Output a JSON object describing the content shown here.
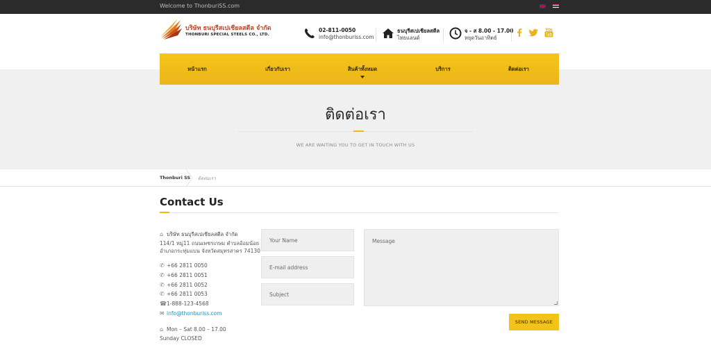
{
  "topbar": {
    "welcome": "Welcome to ThonburiSS.com",
    "flags": [
      "english-flag",
      "thai-flag"
    ]
  },
  "logo": {
    "name_th": "บริษัท ธนบุรีสเปเชียลสตีล จำกัด",
    "name_en": "THONBURI SPECIAL STEELS CO., LTD."
  },
  "header_info": [
    {
      "icon": "phone-icon",
      "line1": "02-811-0050",
      "line2": "info@thonburiss.com"
    },
    {
      "icon": "home-icon",
      "line1": "ธนบุรีสเปเชียลสตีล",
      "line2": "ไทยแลนด์"
    },
    {
      "icon": "clock-icon",
      "line1": "จ - ส 8.00 - 17.00",
      "line2": "หยุดวันอาทิตย์"
    }
  ],
  "social": [
    "facebook-icon",
    "twitter-icon",
    "youtube-icon"
  ],
  "nav": {
    "items": [
      "หน้าแรก",
      "เกี่ยวกับเรา",
      "สินค้าทั้งหมด",
      "บริการ",
      "ติดต่อเรา"
    ]
  },
  "hero": {
    "title": "ติดต่อเรา",
    "subtitle": "WE ARE WAITING YOU TO GET IN TOUCH WITH US"
  },
  "breadcrumb": {
    "home": "Thonburi SS",
    "current": "ติดต่อเรา"
  },
  "contact": {
    "heading": "Contact Us",
    "company": "บริษัท ธนบุรีสเปเชียลสตีล จำกัด",
    "address_line1": "114/1 หมู่11 ถนนเพชรเกษม ตำบลอ้อมน้อย",
    "address_line2": "อำเภอกระทุ่มแบน จังหวัดสมุทรสาคร 74130",
    "phones": [
      "+66 2811 0050",
      "+66 2811 0051",
      "+66 2811 0052",
      "+66 2811 0053"
    ],
    "fax": "1-888-123-4568",
    "email": "info@thonburiss.com",
    "hours": "Mon – Sat 8.00 – 17.00",
    "closed": "Sunday CLOSED"
  },
  "form": {
    "name_placeholder": "Your Name",
    "email_placeholder": "E-mail address",
    "subject_placeholder": "Subject",
    "message_placeholder": "Message",
    "send_label": "SEND MESSAGE"
  },
  "colors": {
    "accent": "#f3c31a",
    "topbar": "#2b2b2b",
    "link": "#1b8fc7"
  }
}
